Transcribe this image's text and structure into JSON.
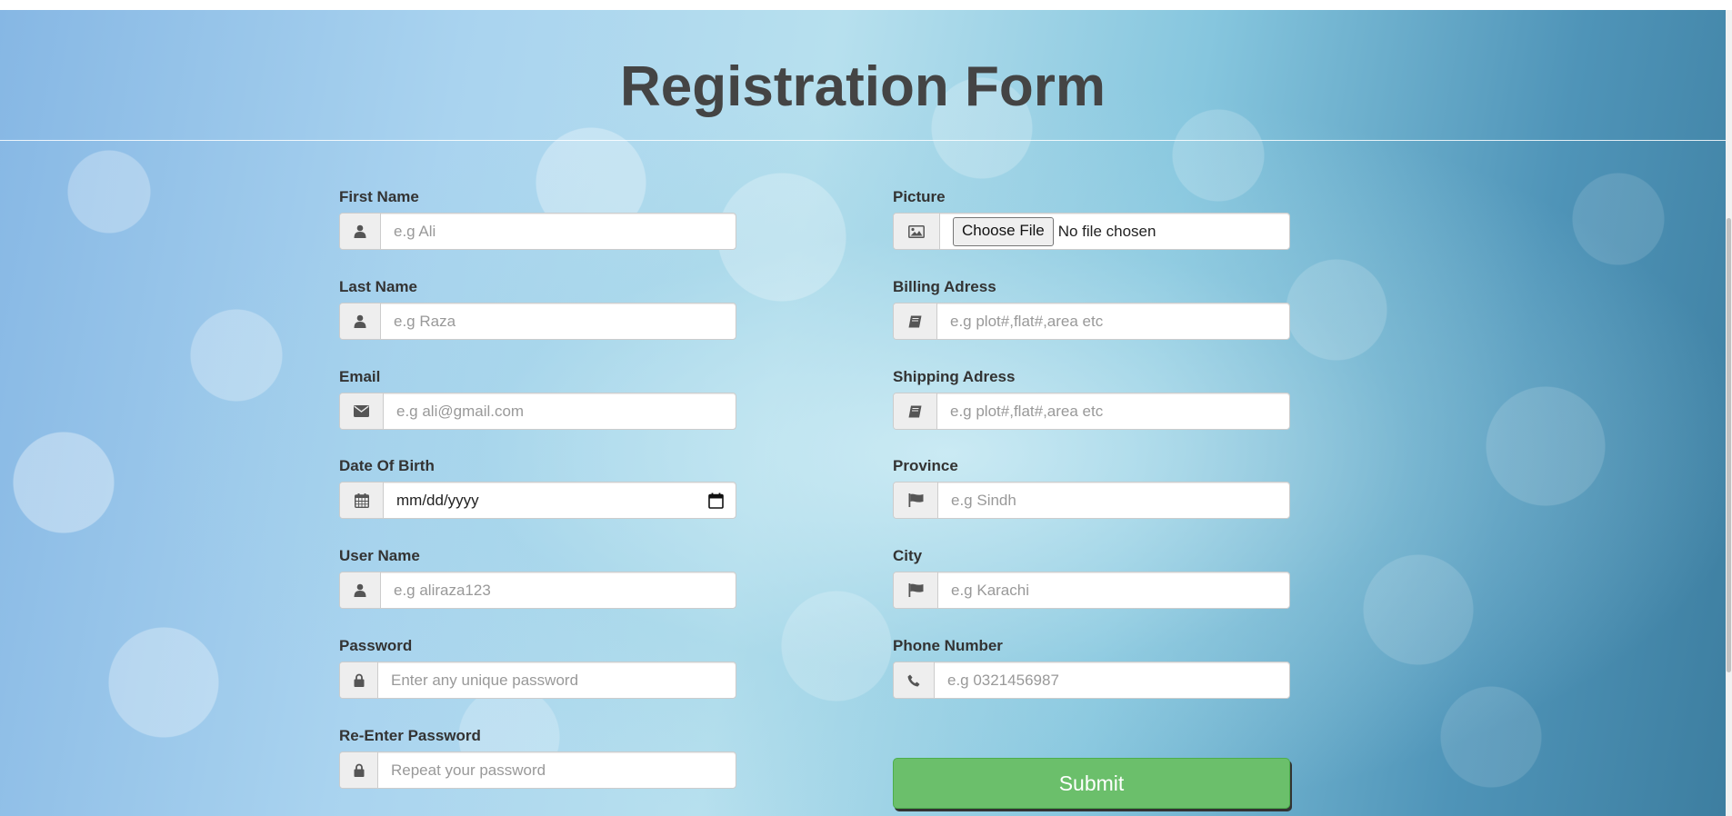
{
  "page": {
    "title": "Registration Form"
  },
  "left_fields": [
    {
      "label": "First Name",
      "placeholder": "e.g Ali",
      "icon": "user-icon"
    },
    {
      "label": "Last Name",
      "placeholder": "e.g Raza",
      "icon": "user-icon"
    },
    {
      "label": "Email",
      "placeholder": "e.g ali@gmail.com",
      "icon": "envelope-icon"
    },
    {
      "label": "Date Of Birth",
      "value": "mm/dd/yyyy",
      "icon": "calendar-icon"
    },
    {
      "label": "User Name",
      "placeholder": "e.g aliraza123",
      "icon": "user-icon"
    },
    {
      "label": "Password",
      "placeholder": "Enter any unique password",
      "icon": "lock-icon"
    },
    {
      "label": "Re-Enter Password",
      "placeholder": "Repeat your password",
      "icon": "lock-icon"
    }
  ],
  "right_fields": [
    {
      "label": "Picture",
      "button": "Choose File",
      "status": "No file chosen",
      "icon": "picture-icon"
    },
    {
      "label": "Billing Adress",
      "placeholder": "e.g plot#,flat#,area etc",
      "icon": "book-icon"
    },
    {
      "label": "Shipping Adress",
      "placeholder": "e.g plot#,flat#,area etc",
      "icon": "book-icon"
    },
    {
      "label": "Province",
      "placeholder": "e.g Sindh",
      "icon": "flag-icon"
    },
    {
      "label": "City",
      "placeholder": "e.g Karachi",
      "icon": "flag-icon"
    },
    {
      "label": "Phone Number",
      "placeholder": "e.g 0321456987",
      "icon": "phone-icon"
    }
  ],
  "submit": {
    "label": "Submit"
  },
  "colors": {
    "submit": "#6bbf6b",
    "title": "#444444",
    "label": "#333333"
  }
}
